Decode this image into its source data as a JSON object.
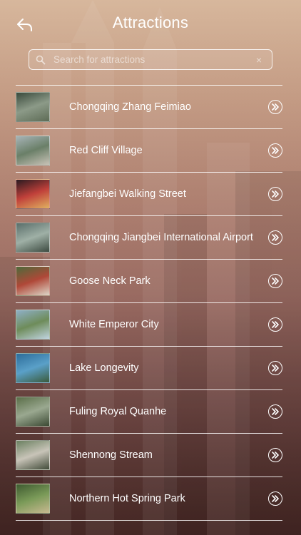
{
  "header": {
    "title": "Attractions",
    "back_icon": "back-arrow-icon"
  },
  "search": {
    "placeholder": "Search for attractions",
    "value": "",
    "clear_symbol": "×"
  },
  "items": [
    {
      "label": "Chongqing Zhang Feimiao",
      "thumb_colors": [
        "#3a4a3c",
        "#8c9a88",
        "#5d6b55"
      ]
    },
    {
      "label": "Red Cliff Village",
      "thumb_colors": [
        "#a8b4b8",
        "#6a7f68",
        "#c8c2b6"
      ]
    },
    {
      "label": "Jiefangbei Walking Street",
      "thumb_colors": [
        "#2a1a20",
        "#c0403a",
        "#e0b060"
      ]
    },
    {
      "label": "Chongqing Jiangbei International Airport",
      "thumb_colors": [
        "#5a6e6a",
        "#9fb0a6",
        "#3c4a40"
      ]
    },
    {
      "label": "Goose Neck Park",
      "thumb_colors": [
        "#4d6a3a",
        "#b04838",
        "#dcd6c8"
      ]
    },
    {
      "label": "White Emperor City",
      "thumb_colors": [
        "#8fb0c8",
        "#6e8c5a",
        "#c0d4e0"
      ]
    },
    {
      "label": "Lake Longevity",
      "thumb_colors": [
        "#2c6c9a",
        "#5aa0c8",
        "#3a5a3a"
      ]
    },
    {
      "label": "Fuling Royal Quanhe",
      "thumb_colors": [
        "#5a6e48",
        "#9aa890",
        "#3c4a34"
      ]
    },
    {
      "label": "Shennong Stream",
      "thumb_colors": [
        "#6a8060",
        "#c8c4b8",
        "#404a38"
      ]
    },
    {
      "label": "Northern Hot Spring Park",
      "thumb_colors": [
        "#3e5a30",
        "#7a9a58",
        "#c8b890"
      ]
    }
  ],
  "item_action_icon": "double-chevron-right-icon",
  "colors": {
    "accent": "#ffffff",
    "bg_top": "#d7b79c",
    "bg_bottom": "#4f3231"
  }
}
